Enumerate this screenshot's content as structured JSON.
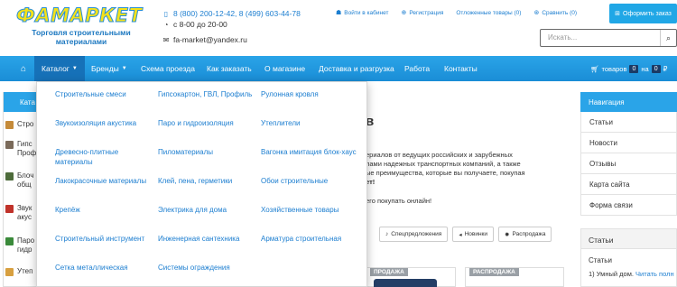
{
  "header": {
    "logo_text": "ФАМАРКЕТ",
    "tagline": "Торговля строительными материалами",
    "phones": "8 (800) 200-12-42, 8 (499) 603-44-78",
    "hours": "с 8-00 до 20-00",
    "email": "fa-market@yandex.ru",
    "links": {
      "login": "Войти в кабинет",
      "register": "Регистрация",
      "deferred": "Отложенные товары (0)",
      "compare": "Сравнить (0)"
    },
    "order_button": "Оформить заказ",
    "search_placeholder": "Искать..."
  },
  "nav": {
    "items": [
      "Каталог",
      "Бренды",
      "Схема проезда",
      "Как заказать",
      "О магазине",
      "Доставка и разгрузка",
      "Работа",
      "Контакты"
    ],
    "cart_label": "товаров",
    "cart_count": "0",
    "cart_on": "на",
    "cart_sum": "0",
    "currency": "₽"
  },
  "catalog_dropdown": {
    "col1": [
      "Строительные смеси",
      "Звукоизоляция акустика",
      "Древесно-плитные материалы",
      "Лакокрасочные материалы",
      "Крепёж",
      "Строительный инструмент",
      "Сетка металлическая"
    ],
    "col2": [
      "Гипсокартон, ГВЛ, Профиль",
      "Паро и гидроизоляция",
      "Пиломатериалы",
      "Клей, пена, герметики",
      "Электрика для дома",
      "Инженерная сантехника",
      "Системы ограждения"
    ],
    "col3": [
      "Рулонная кровля",
      "Утеплители",
      "Вагонка имитация блок-хаус",
      "Обои строительные",
      "Хозяйственные товары",
      "Арматура строительная"
    ]
  },
  "left_panel": {
    "heading": "Ката",
    "rows": [
      "Стро",
      "Гипс Проф",
      "Блоч общ",
      "Звук акус",
      "Паро гидр",
      "Утеп"
    ]
  },
  "main": {
    "heading": "в",
    "text1": "ериалов от ведущих российских и зарубежных",
    "text2": "лами надежных транспортных компаний, а также",
    "text3": "ые преимущества, которые вы получаете, покупая",
    "text4": "ет!",
    "text5": "его покупать онлайн!",
    "tabs": [
      "Спецпредложения",
      "Новинки",
      "Распродажа"
    ],
    "ribbon1": "ПРОДАЖА",
    "ribbon2": "РАСПРОДАЖА"
  },
  "right": {
    "nav_heading": "Навигация",
    "links": [
      "Статьи",
      "Новости",
      "Отзывы",
      "Карта сайта",
      "Форма связи"
    ],
    "articles_heading": "Статьи",
    "articles_sub": "Статьи",
    "article1_prefix": "1) Умный дом.",
    "article1_link": "Читать полн"
  },
  "colors": {
    "nav_blue": "#1a8dd6",
    "link_blue": "#1c7ed0",
    "logo_yellow": "#f4e11a"
  }
}
